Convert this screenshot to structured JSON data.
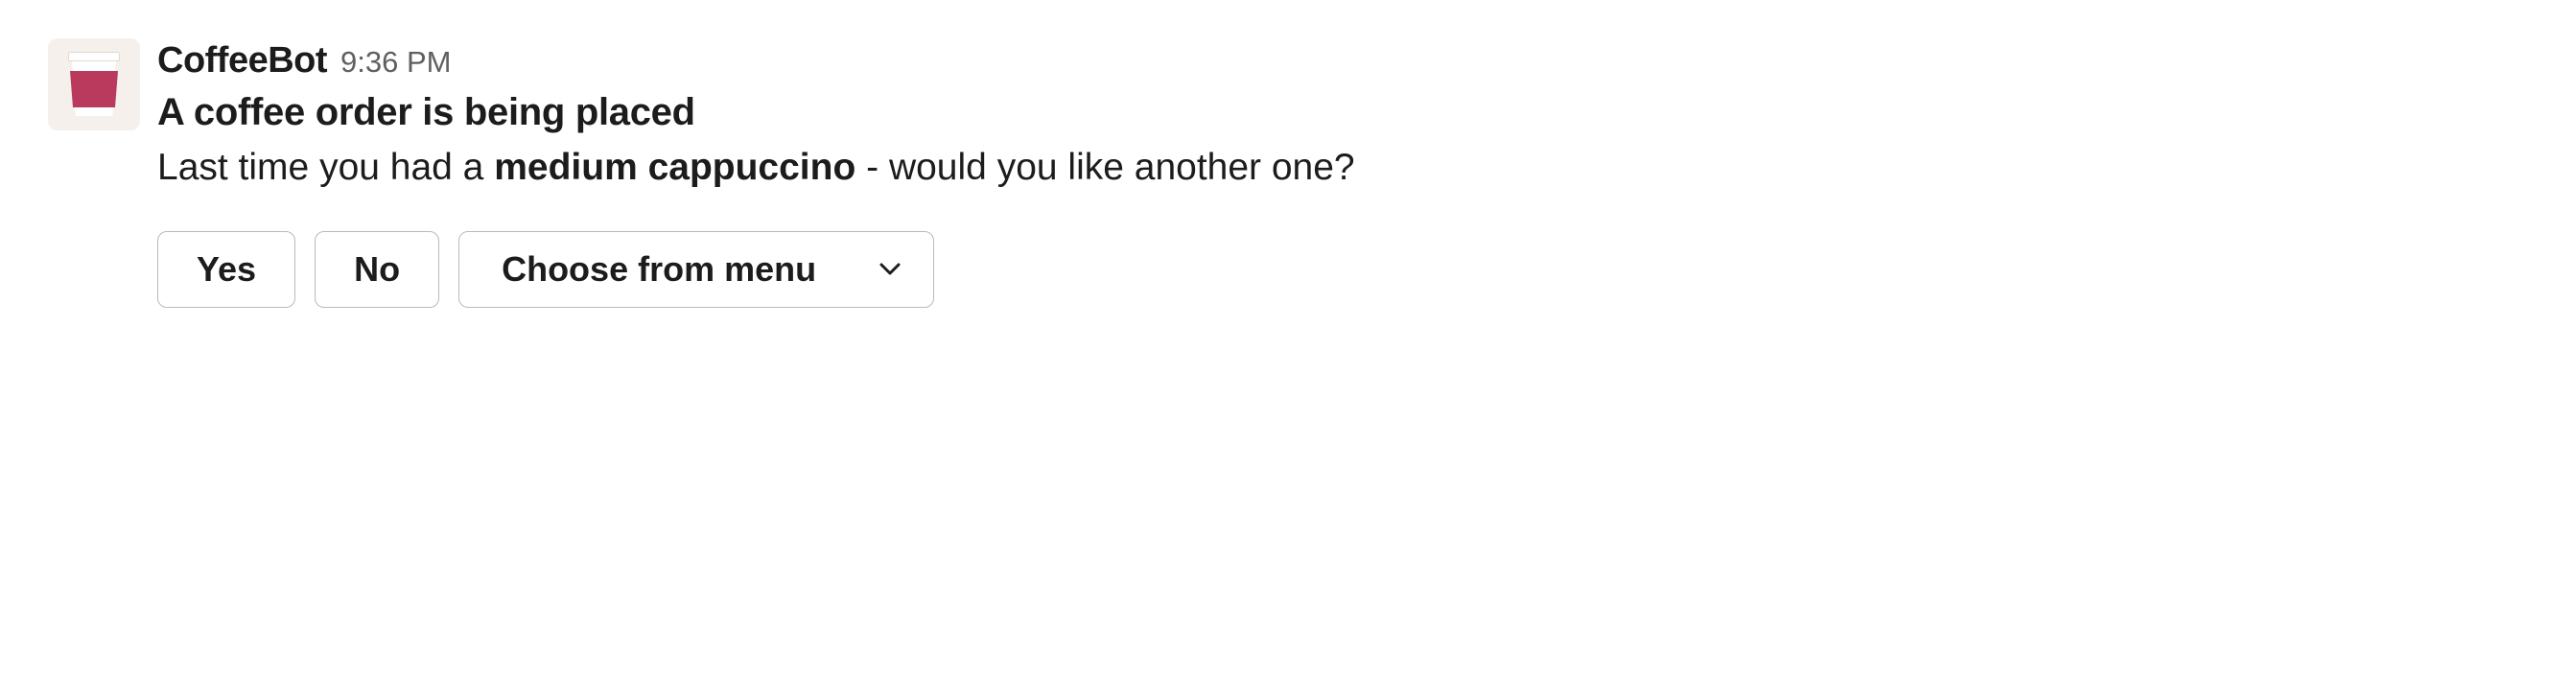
{
  "message": {
    "bot_name": "CoffeeBot",
    "timestamp": "9:36 PM",
    "title": "A coffee order is being placed",
    "body": {
      "prefix": "Last time you had a ",
      "emphasis": "medium cappuccino",
      "suffix": " - would you like another one?"
    },
    "actions": {
      "yes_label": "Yes",
      "no_label": "No",
      "select_placeholder": "Choose from menu"
    },
    "avatar": {
      "icon": "coffee-cup-icon",
      "sleeve_color": "#b93a5d"
    }
  }
}
